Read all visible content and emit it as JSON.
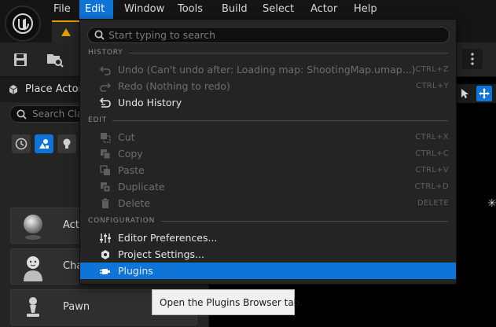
{
  "menubar": {
    "items": [
      {
        "label": "File"
      },
      {
        "label": "Edit"
      },
      {
        "label": "Window"
      },
      {
        "label": "Tools"
      },
      {
        "label": "Build"
      },
      {
        "label": "Select"
      },
      {
        "label": "Actor"
      },
      {
        "label": "Help"
      }
    ],
    "active": "Edit"
  },
  "left_panel": {
    "title": "Place Actors",
    "search_placeholder": "Search Cla",
    "actors": [
      {
        "label": "Acto"
      },
      {
        "label": "Cha"
      },
      {
        "label": "Pawn"
      }
    ]
  },
  "edit_menu": {
    "search_placeholder": "Start typing to search",
    "sections": {
      "history": "HISTORY",
      "edit": "EDIT",
      "configuration": "CONFIGURATION"
    },
    "history_items": [
      {
        "label": "Undo (Can't undo after: Loading map: ShootingMap.umap...)",
        "shortcut": "CTRL+Z",
        "enabled": false,
        "icon": "undo-icon"
      },
      {
        "label": "Redo (Nothing to redo)",
        "shortcut": "CTRL+Y",
        "enabled": false,
        "icon": "redo-icon"
      },
      {
        "label": "Undo History",
        "shortcut": "",
        "enabled": true,
        "icon": "undo-history-icon"
      }
    ],
    "edit_items": [
      {
        "label": "Cut",
        "shortcut": "CTRL+X",
        "enabled": false,
        "icon": "cut-icon"
      },
      {
        "label": "Copy",
        "shortcut": "CTRL+C",
        "enabled": false,
        "icon": "copy-icon"
      },
      {
        "label": "Paste",
        "shortcut": "CTRL+V",
        "enabled": false,
        "icon": "paste-icon"
      },
      {
        "label": "Duplicate",
        "shortcut": "CTRL+D",
        "enabled": false,
        "icon": "duplicate-icon"
      },
      {
        "label": "Delete",
        "shortcut": "DELETE",
        "enabled": false,
        "icon": "trash-icon"
      }
    ],
    "config_items": [
      {
        "label": "Editor Preferences...",
        "icon": "sliders-icon"
      },
      {
        "label": "Project Settings...",
        "icon": "settings-icon"
      },
      {
        "label": "Plugins",
        "icon": "plug-icon",
        "highlighted": true
      }
    ]
  },
  "tooltip": {
    "text": "Open the Plugins Browser tab."
  },
  "colors": {
    "accent": "#0e74d8",
    "tab_accent": "#e59b00"
  }
}
